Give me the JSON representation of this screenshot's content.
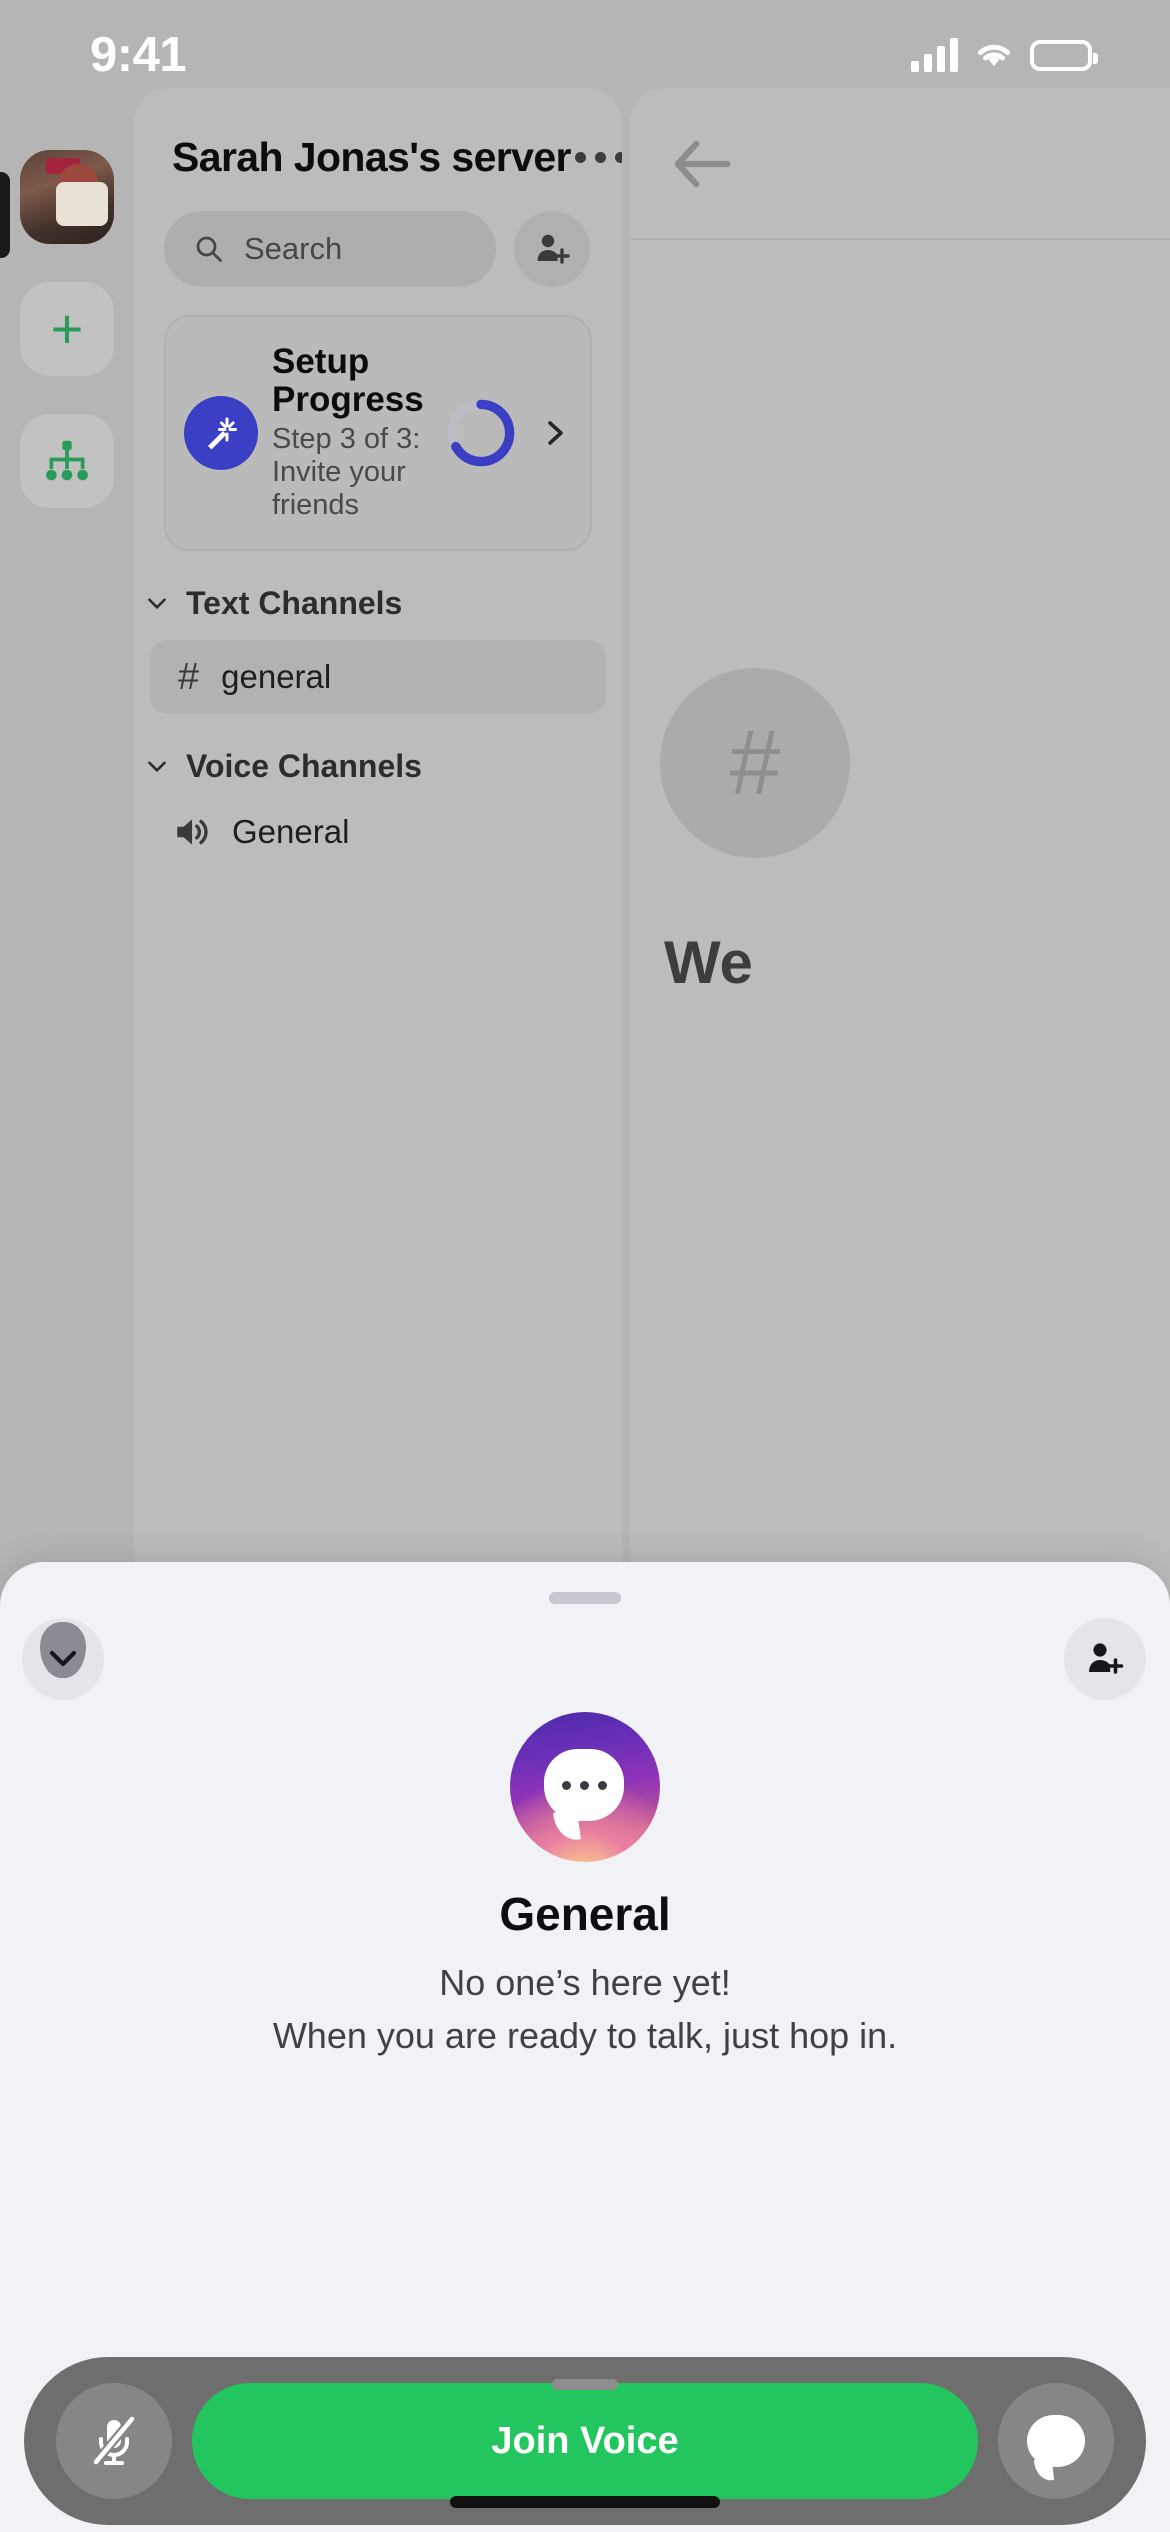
{
  "status_bar": {
    "time": "9:41",
    "signal_icon": "cellular-signal-icon",
    "wifi_icon": "wifi-icon",
    "battery_icon": "battery-icon"
  },
  "server_rail": {
    "items": [
      {
        "name": "server-avatar",
        "icon": "server-avatar-image",
        "label": ""
      },
      {
        "name": "add-server",
        "icon": "plus-icon",
        "label": "+"
      },
      {
        "name": "explore-servers",
        "icon": "server-discovery-icon",
        "label": ""
      }
    ]
  },
  "channel_panel": {
    "server_name": "Sarah Jonas's server",
    "more_icon": "more-horizontal-icon",
    "search": {
      "placeholder": "Search",
      "icon": "search-icon"
    },
    "invite_button_icon": "person-add-icon",
    "setup_card": {
      "icon": "magic-wand-icon",
      "title": "Setup Progress",
      "subtitle": "Step 3 of 3: Invite your friends",
      "progress_percent": 67,
      "progress_color": "#3b3fc4",
      "track_color": "#bcbcc6",
      "chevron_icon": "chevron-right-icon"
    },
    "sections": [
      {
        "label": "Text Channels",
        "chevron_icon": "chevron-down-icon",
        "channels": [
          {
            "name": "general",
            "icon": "hash-icon",
            "active": true
          }
        ]
      },
      {
        "label": "Voice Channels",
        "chevron_icon": "chevron-down-icon",
        "channels": [
          {
            "name": "General",
            "icon": "speaker-icon",
            "active": false
          }
        ]
      }
    ]
  },
  "content_peek": {
    "back_icon": "arrow-left-icon",
    "hash_icon": "hash-icon",
    "hash_glyph": "#",
    "welcome_text": "We"
  },
  "voice_sheet": {
    "grabber_icon": "sheet-grabber",
    "collapse_icon": "chevron-down-icon",
    "invite_icon": "person-add-icon",
    "channel_avatar_icon": "chat-bubble-avatar",
    "channel_name": "General",
    "empty_line_1": "No one’s here yet!",
    "empty_line_2": "When you are ready to talk, just hop in.",
    "controls": {
      "mic_icon": "microphone-muted-icon",
      "join_label": "Join Voice",
      "join_color": "#22c55e",
      "chat_icon": "chat-bubble-icon"
    }
  }
}
